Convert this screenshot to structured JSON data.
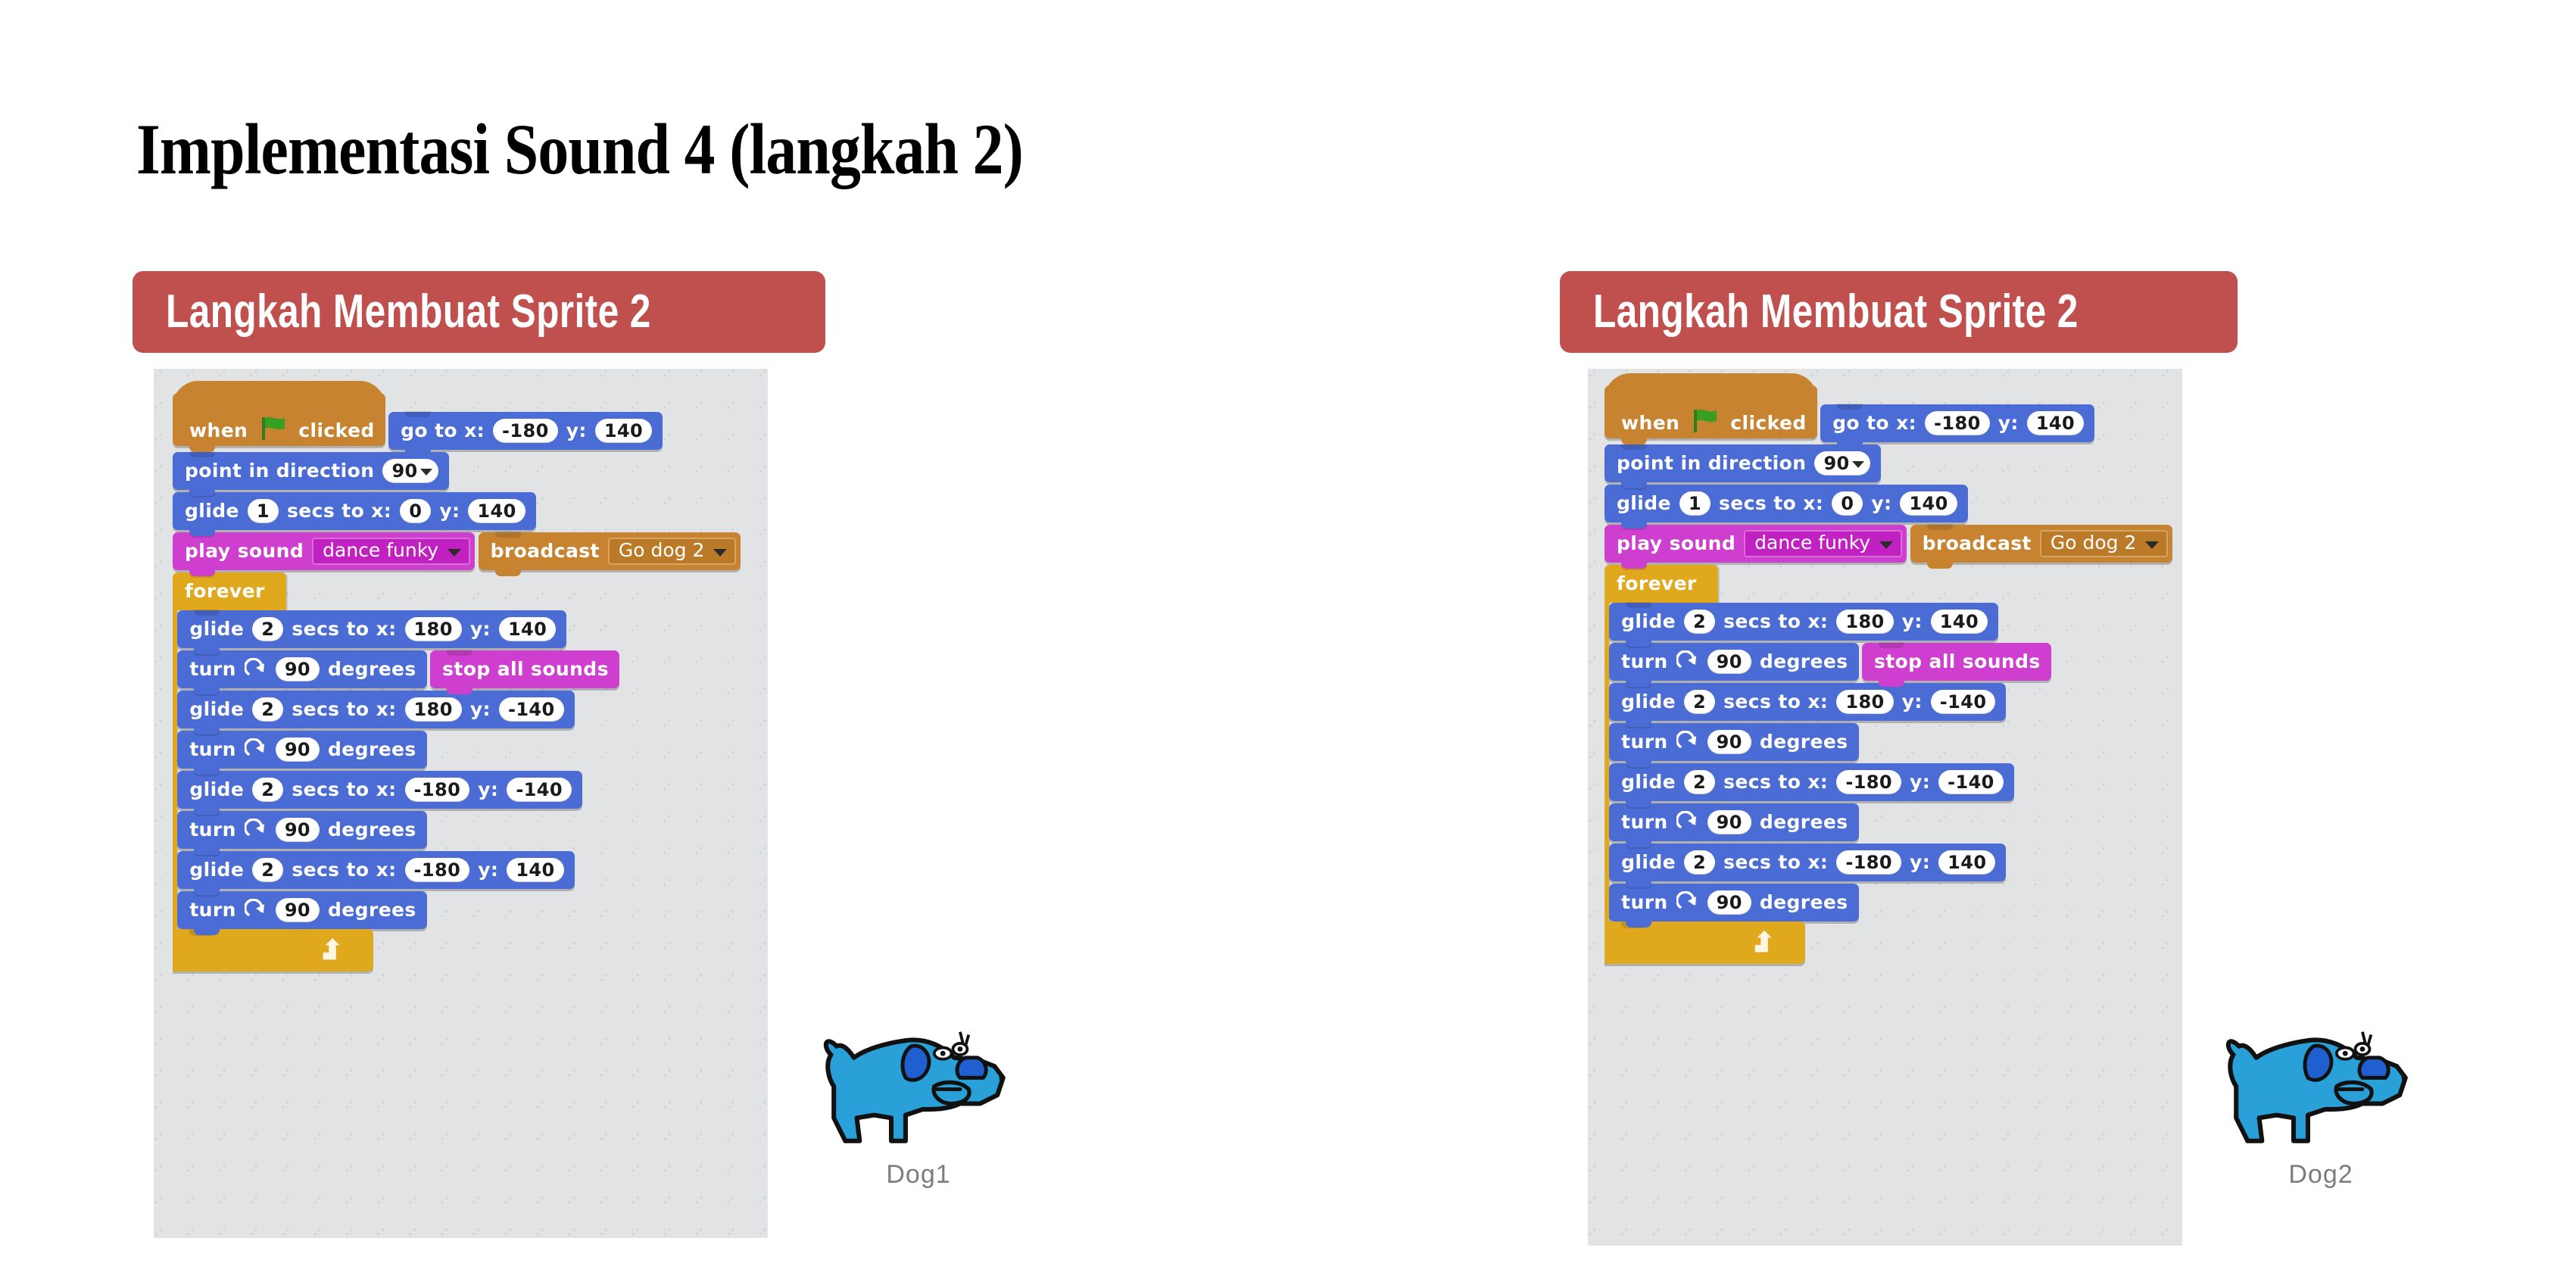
{
  "slide": {
    "title": "Implementasi Sound 4 (langkah 2)",
    "background_color": "#ffffff"
  },
  "colors": {
    "banner_red": "#c0504d",
    "canvas_gray": "#e2e3e4",
    "motion_blue": "#4a6cd4",
    "sound_magenta": "#cf3fcf",
    "event_brown": "#c88330",
    "control_gold": "#e0a81c",
    "sprite_blue": "#29a0d8",
    "label_gray": "#7c7c7c"
  },
  "columns": [
    {
      "banner_label": "Langkah Membuat Sprite 2",
      "sprite_name": "Dog1",
      "script": {
        "hat": {
          "word1": "when",
          "icon": "green-flag-icon",
          "word2": "clicked"
        },
        "blocks": [
          {
            "type": "motion",
            "kind": "go-to-xy",
            "label1": "go to x:",
            "value1": "-180",
            "label2": "y:",
            "value2": "140"
          },
          {
            "type": "motion",
            "kind": "point-direction",
            "label1": "point in direction",
            "value1": "90"
          },
          {
            "type": "motion",
            "kind": "glide",
            "label1": "glide",
            "value1": "1",
            "label2": "secs to x:",
            "value2": "0",
            "label3": "y:",
            "value3": "140"
          },
          {
            "type": "sound",
            "kind": "play-sound",
            "label1": "play sound",
            "value1": "dance funky"
          },
          {
            "type": "event",
            "kind": "broadcast",
            "label1": "broadcast",
            "value1": "Go dog 2"
          }
        ],
        "forever": {
          "label": "forever",
          "blocks": [
            {
              "type": "motion",
              "kind": "glide",
              "label1": "glide",
              "value1": "2",
              "label2": "secs to x:",
              "value2": "180",
              "label3": "y:",
              "value3": "140"
            },
            {
              "type": "motion",
              "kind": "turn",
              "label1": "turn",
              "icon": "turn-cw-icon",
              "value1": "90",
              "label2": "degrees"
            },
            {
              "type": "sound",
              "kind": "stop-all-sounds",
              "label1": "stop all sounds"
            },
            {
              "type": "motion",
              "kind": "glide",
              "label1": "glide",
              "value1": "2",
              "label2": "secs to x:",
              "value2": "180",
              "label3": "y:",
              "value3": "-140"
            },
            {
              "type": "motion",
              "kind": "turn",
              "label1": "turn",
              "icon": "turn-cw-icon",
              "value1": "90",
              "label2": "degrees"
            },
            {
              "type": "motion",
              "kind": "glide",
              "label1": "glide",
              "value1": "2",
              "label2": "secs to x:",
              "value2": "-180",
              "label3": "y:",
              "value3": "-140"
            },
            {
              "type": "motion",
              "kind": "turn",
              "label1": "turn",
              "icon": "turn-cw-icon",
              "value1": "90",
              "label2": "degrees"
            },
            {
              "type": "motion",
              "kind": "glide",
              "label1": "glide",
              "value1": "2",
              "label2": "secs to x:",
              "value2": "-180",
              "label3": "y:",
              "value3": "140"
            },
            {
              "type": "motion",
              "kind": "turn",
              "label1": "turn",
              "icon": "turn-cw-icon",
              "value1": "90",
              "label2": "degrees"
            }
          ]
        }
      }
    },
    {
      "banner_label": "Langkah Membuat Sprite 2",
      "sprite_name": "Dog2",
      "script": {
        "hat": {
          "word1": "when",
          "icon": "green-flag-icon",
          "word2": "clicked"
        },
        "blocks": [
          {
            "type": "motion",
            "kind": "go-to-xy",
            "label1": "go to x:",
            "value1": "-180",
            "label2": "y:",
            "value2": "140"
          },
          {
            "type": "motion",
            "kind": "point-direction",
            "label1": "point in direction",
            "value1": "90"
          },
          {
            "type": "motion",
            "kind": "glide",
            "label1": "glide",
            "value1": "1",
            "label2": "secs to x:",
            "value2": "0",
            "label3": "y:",
            "value3": "140"
          },
          {
            "type": "sound",
            "kind": "play-sound",
            "label1": "play sound",
            "value1": "dance funky"
          },
          {
            "type": "event",
            "kind": "broadcast",
            "label1": "broadcast",
            "value1": "Go dog 2"
          }
        ],
        "forever": {
          "label": "forever",
          "blocks": [
            {
              "type": "motion",
              "kind": "glide",
              "label1": "glide",
              "value1": "2",
              "label2": "secs to x:",
              "value2": "180",
              "label3": "y:",
              "value3": "140"
            },
            {
              "type": "motion",
              "kind": "turn",
              "label1": "turn",
              "icon": "turn-cw-icon",
              "value1": "90",
              "label2": "degrees"
            },
            {
              "type": "sound",
              "kind": "stop-all-sounds",
              "label1": "stop all sounds"
            },
            {
              "type": "motion",
              "kind": "glide",
              "label1": "glide",
              "value1": "2",
              "label2": "secs to x:",
              "value2": "180",
              "label3": "y:",
              "value3": "-140"
            },
            {
              "type": "motion",
              "kind": "turn",
              "label1": "turn",
              "icon": "turn-cw-icon",
              "value1": "90",
              "label2": "degrees"
            },
            {
              "type": "motion",
              "kind": "glide",
              "label1": "glide",
              "value1": "2",
              "label2": "secs to x:",
              "value2": "-180",
              "label3": "y:",
              "value3": "-140"
            },
            {
              "type": "motion",
              "kind": "turn",
              "label1": "turn",
              "icon": "turn-cw-icon",
              "value1": "90",
              "label2": "degrees"
            },
            {
              "type": "motion",
              "kind": "glide",
              "label1": "glide",
              "value1": "2",
              "label2": "secs to x:",
              "value2": "-180",
              "label3": "y:",
              "value3": "140"
            },
            {
              "type": "motion",
              "kind": "turn",
              "label1": "turn",
              "icon": "turn-cw-icon",
              "value1": "90",
              "label2": "degrees"
            }
          ]
        }
      }
    }
  ]
}
